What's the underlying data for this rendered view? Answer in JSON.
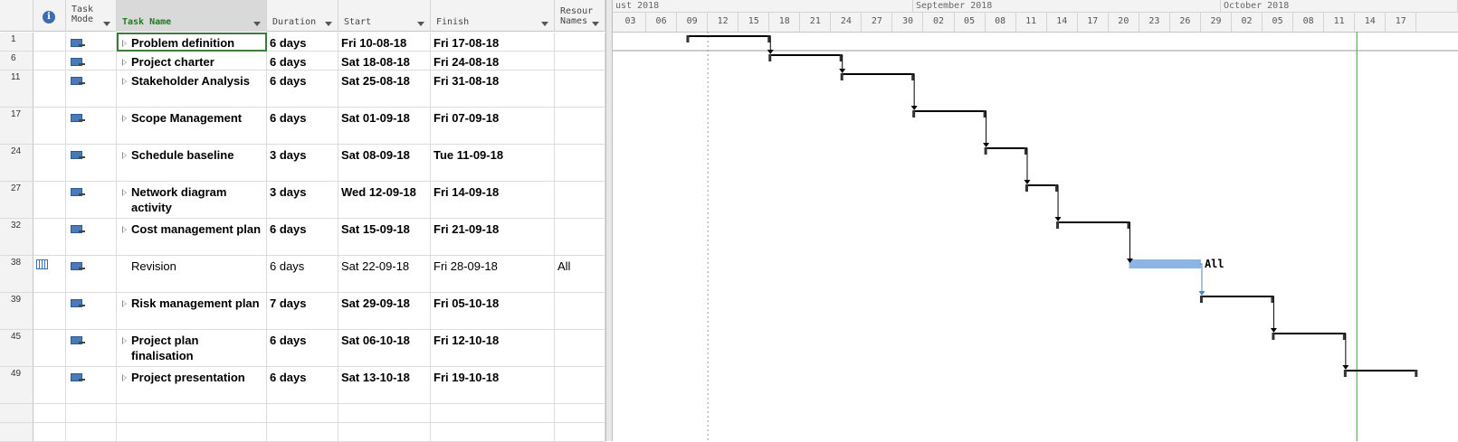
{
  "columns": {
    "info": "i",
    "task_mode": "Task\nMode",
    "task_name": "Task Name",
    "duration": "Duration",
    "start": "Start",
    "finish": "Finish",
    "resource": "Resour\nNames"
  },
  "rows": [
    {
      "id": "1",
      "name": "Problem definition",
      "duration": "6 days",
      "start": "Fri 10-08-18",
      "finish": "Fri 17-08-18",
      "resource": "",
      "summary": true
    },
    {
      "id": "6",
      "name": "Project charter",
      "duration": "6 days",
      "start": "Sat 18-08-18",
      "finish": "Fri 24-08-18",
      "resource": "",
      "summary": true
    },
    {
      "id": "11",
      "name": "Stakeholder Analysis",
      "duration": "6 days",
      "start": "Sat 25-08-18",
      "finish": "Fri 31-08-18",
      "resource": "",
      "summary": true
    },
    {
      "id": "17",
      "name": "Scope Management",
      "duration": "6 days",
      "start": "Sat 01-09-18",
      "finish": "Fri 07-09-18",
      "resource": "",
      "summary": true
    },
    {
      "id": "24",
      "name": "Schedule baseline",
      "duration": "3 days",
      "start": "Sat 08-09-18",
      "finish": "Tue 11-09-18",
      "resource": "",
      "summary": true
    },
    {
      "id": "27",
      "name": "Network diagram activity",
      "duration": "3 days",
      "start": "Wed 12-09-18",
      "finish": "Fri 14-09-18",
      "resource": "",
      "summary": true
    },
    {
      "id": "32",
      "name": "Cost management plan",
      "duration": "6 days",
      "start": "Sat 15-09-18",
      "finish": "Fri 21-09-18",
      "resource": "",
      "summary": true
    },
    {
      "id": "38",
      "name": "Revision",
      "duration": "6 days",
      "start": "Sat 22-09-18",
      "finish": "Fri 28-09-18",
      "resource": "All",
      "summary": false
    },
    {
      "id": "39",
      "name": "Risk management plan",
      "duration": "7 days",
      "start": "Sat 29-09-18",
      "finish": "Fri 05-10-18",
      "resource": "",
      "summary": true
    },
    {
      "id": "45",
      "name": "Project plan finalisation",
      "duration": "6 days",
      "start": "Sat 06-10-18",
      "finish": "Fri 12-10-18",
      "resource": "",
      "summary": true
    },
    {
      "id": "49",
      "name": "Project presentation",
      "duration": "6 days",
      "start": "Sat 13-10-18",
      "finish": "Fri 19-10-18",
      "resource": "",
      "summary": true
    }
  ],
  "timeline": {
    "months": [
      "ust 2018",
      "September 2018",
      "October 2018"
    ],
    "days": [
      "03",
      "06",
      "09",
      "12",
      "15",
      "18",
      "21",
      "24",
      "27",
      "30",
      "02",
      "05",
      "08",
      "11",
      "14",
      "17",
      "20",
      "23",
      "26",
      "29",
      "02",
      "05",
      "08",
      "11",
      "14",
      "17"
    ],
    "bar_label": "All"
  },
  "colors": {
    "summary_bar": "#000000",
    "task_bar": "#8db4e2",
    "link_arrow": "#4a86c8",
    "today_line": "#3a9a3a",
    "selected_border": "#3a7d3a"
  }
}
